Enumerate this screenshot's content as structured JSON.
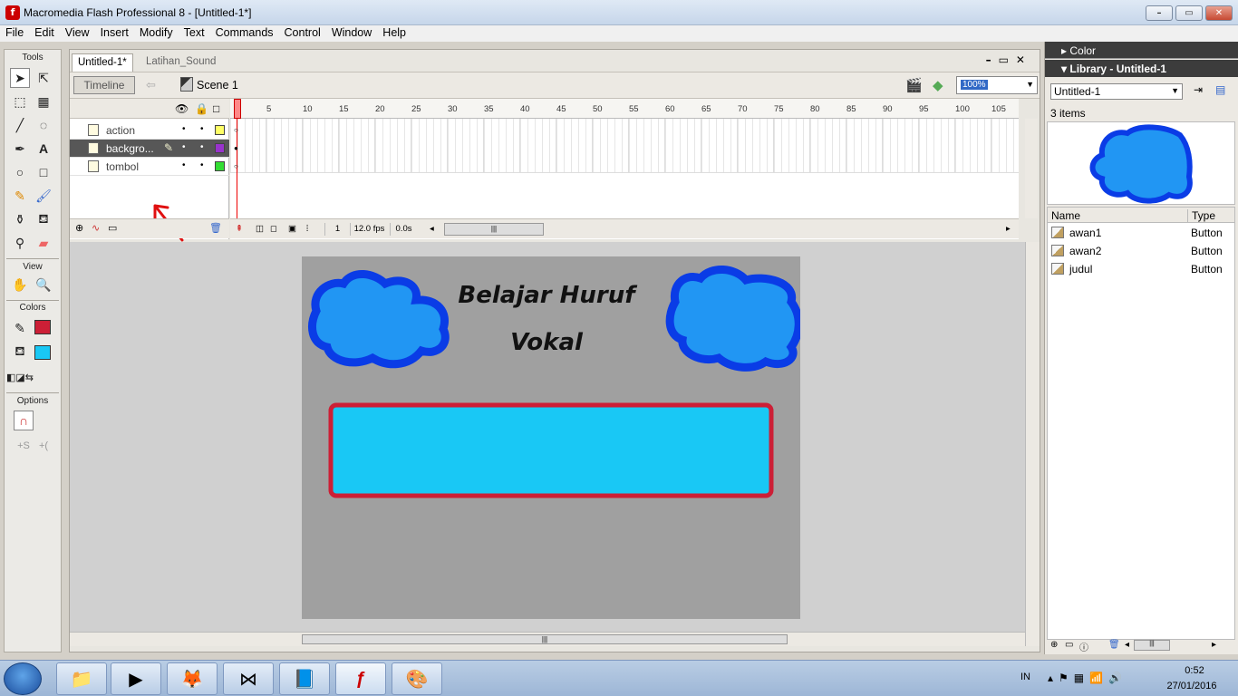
{
  "window": {
    "title": "Macromedia Flash Professional 8 - [Untitled-1*]",
    "app_icon": "flash-icon",
    "controls": [
      "minimize",
      "maximize",
      "close"
    ]
  },
  "menu": [
    "File",
    "Edit",
    "View",
    "Insert",
    "Modify",
    "Text",
    "Commands",
    "Control",
    "Window",
    "Help"
  ],
  "tools": {
    "title": "Tools",
    "view_title": "View",
    "colors_title": "Colors",
    "options_title": "Options",
    "stroke_color": "#cc1f36",
    "fill_color": "#19c8f5"
  },
  "document": {
    "tabs": [
      "Untitled-1*",
      "Latihan_Sound"
    ],
    "timeline_button": "Timeline",
    "scene": "Scene 1",
    "zoom": "100%"
  },
  "timeline": {
    "layers": [
      {
        "name": "action",
        "color": "#ffff66",
        "selected": false
      },
      {
        "name": "backgro...",
        "color": "#9933cc",
        "selected": true
      },
      {
        "name": "tombol",
        "color": "#33dd33",
        "selected": false
      }
    ],
    "ruler": [
      "1",
      "5",
      "10",
      "15",
      "20",
      "25",
      "30",
      "35",
      "40",
      "45",
      "50",
      "55",
      "60",
      "65",
      "70",
      "75",
      "80",
      "85",
      "90",
      "95",
      "100",
      "105"
    ],
    "current_frame": "1",
    "fps": "12.0 fps",
    "time": "0.0s"
  },
  "stage": {
    "title_line1": "Belajar Huruf",
    "title_line2": "Vokal",
    "background": "#a0a0a0",
    "cloud_fill": "#2196f3",
    "cloud_stroke": "#0a3ce6",
    "box_fill": "#19c8f5",
    "box_stroke": "#cc1f36"
  },
  "panels": {
    "color_title": "Color",
    "library_title": "Library - Untitled-1",
    "library_select": "Untitled-1",
    "item_count": "3 items",
    "col_name": "Name",
    "col_type": "Type",
    "items": [
      {
        "name": "awan1",
        "type": "Button"
      },
      {
        "name": "awan2",
        "type": "Button"
      },
      {
        "name": "judul",
        "type": "Button"
      }
    ]
  },
  "taskbar": {
    "lang": "IN",
    "time": "0:52",
    "date": "27/01/2016"
  }
}
